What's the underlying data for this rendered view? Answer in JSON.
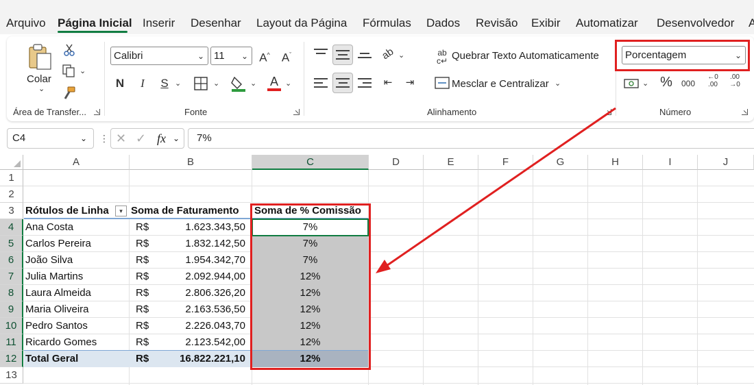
{
  "menu": {
    "tabs": [
      "Arquivo",
      "Página Inicial",
      "Inserir",
      "Desenhar",
      "Layout da Página",
      "Fórmulas",
      "Dados",
      "Revisão",
      "Exibir",
      "Automatizar",
      "Desenvolvedor",
      "A"
    ],
    "active": "Página Inicial"
  },
  "ribbon": {
    "clipboard": {
      "paste_label": "Colar",
      "group_label": "Área de Transfer..."
    },
    "font": {
      "font_name": "Calibri",
      "font_size": "11",
      "bold": "N",
      "italic": "I",
      "underline": "S",
      "group_label": "Fonte"
    },
    "alignment": {
      "wrap_text": "Quebrar Texto Automaticamente",
      "merge_center": "Mesclar e Centralizar",
      "group_label": "Alinhamento"
    },
    "number": {
      "format": "Porcentagem",
      "percent": "%",
      "thousands": "000",
      "group_label": "Número"
    }
  },
  "formula_bar": {
    "name_box": "C4",
    "fx": "fx",
    "value": "7%"
  },
  "columns": [
    "A",
    "B",
    "C",
    "D",
    "E",
    "F",
    "G",
    "H",
    "I",
    "J"
  ],
  "rows": [
    "1",
    "2",
    "3",
    "4",
    "5",
    "6",
    "7",
    "8",
    "9",
    "10",
    "11",
    "12",
    "13"
  ],
  "pivot": {
    "headers": {
      "a": "Rótulos de Linha",
      "b": "Soma de Faturamento",
      "c": "Soma de % Comissão"
    },
    "currency": "R$",
    "data": [
      {
        "name": "Ana Costa",
        "value": "1.623.343,50",
        "pct": "7%"
      },
      {
        "name": "Carlos Pereira",
        "value": "1.832.142,50",
        "pct": "7%"
      },
      {
        "name": "João Silva",
        "value": "1.954.342,70",
        "pct": "7%"
      },
      {
        "name": "Julia Martins",
        "value": "2.092.944,00",
        "pct": "12%"
      },
      {
        "name": "Laura Almeida",
        "value": "2.806.326,20",
        "pct": "12%"
      },
      {
        "name": "Maria Oliveira",
        "value": "2.163.536,50",
        "pct": "12%"
      },
      {
        "name": "Pedro Santos",
        "value": "2.226.043,70",
        "pct": "12%"
      },
      {
        "name": "Ricardo Gomes",
        "value": "2.123.542,00",
        "pct": "12%"
      }
    ],
    "total": {
      "name": "Total Geral",
      "value": "16.822.221,10",
      "pct": "12%"
    }
  },
  "colors": {
    "accent": "#107c41",
    "highlight": "#e02020",
    "selection": "#c8c8c8",
    "total_row": "#dce6f0"
  }
}
